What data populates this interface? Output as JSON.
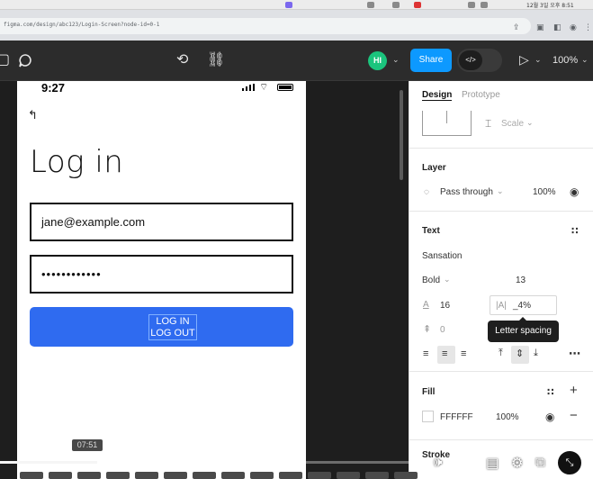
{
  "browser": {
    "url": "figma.com/design/abc123/Login-Screen?node-id=0-1",
    "menubar": {
      "time_text": "12월 3일 오후 8:51"
    }
  },
  "toolbar": {
    "avatar_initials": "HI",
    "share_label": "Share",
    "dev_mode_icon": "</>",
    "zoom": "100%"
  },
  "phone": {
    "status_time": "9:27",
    "title": "Log in",
    "email_value": "jane@example.com",
    "password_value": "••••••••••••",
    "button_line1": "LOG IN",
    "button_line2": "LOG OUT"
  },
  "panel": {
    "tabs": [
      "Design",
      "Prototype"
    ],
    "scale_label": "Scale",
    "layer": {
      "title": "Layer",
      "blend": "Pass through",
      "opacity": "100%"
    },
    "text": {
      "title": "Text",
      "font_family": "Sansation",
      "font_weight": "Bold",
      "font_size": "13",
      "line_height": "16",
      "letter_spacing_icon": "|A|",
      "letter_spacing": "_4%",
      "paragraph_spacing": "0",
      "tooltip": "Letter spacing"
    },
    "fill": {
      "title": "Fill",
      "hex": "FFFFFF",
      "opacity": "100%",
      "color": "#ffffff"
    },
    "stroke_title": "Stroke"
  },
  "video": {
    "hover_time": "07:51",
    "progress_fraction": 0.164
  }
}
